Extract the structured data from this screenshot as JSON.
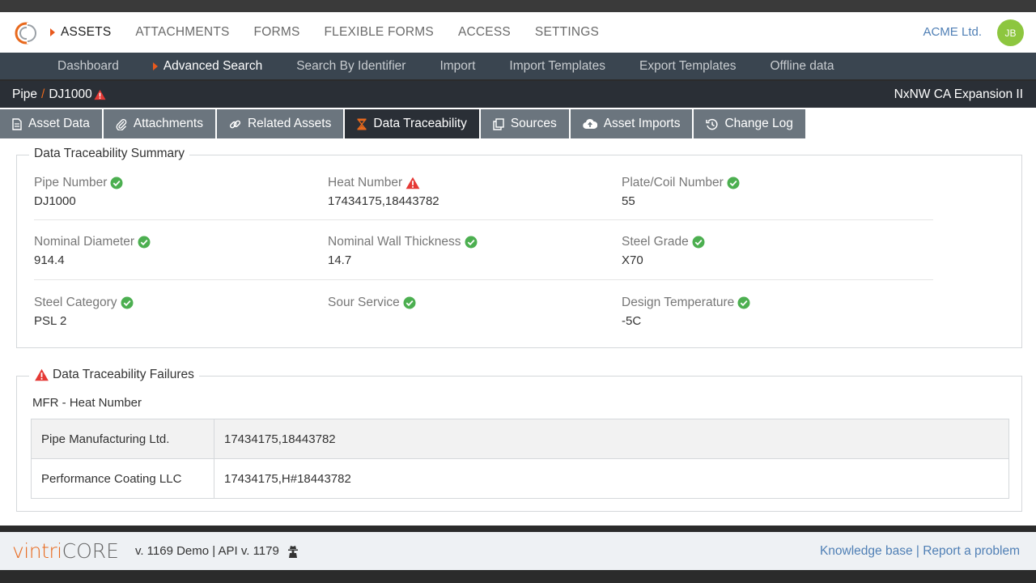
{
  "colors": {
    "accent": "#e8591d",
    "ok": "#4caf50",
    "warn": "#e53935",
    "avatar": "#8dc63f",
    "link": "#4f7fb5"
  },
  "topnav": {
    "items": [
      "ASSETS",
      "ATTACHMENTS",
      "FORMS",
      "FLEXIBLE FORMS",
      "ACCESS",
      "SETTINGS"
    ],
    "company": "ACME Ltd.",
    "avatar_initials": "JB"
  },
  "subnav": {
    "items": [
      "Dashboard",
      "Advanced Search",
      "Search By Identifier",
      "Import",
      "Import Templates",
      "Export Templates",
      "Offline data"
    ]
  },
  "breadcrumb": {
    "parent": "Pipe",
    "sep": "/",
    "current": "DJ1000",
    "project": "NxNW CA Expansion II"
  },
  "tabs": [
    "Asset Data",
    "Attachments",
    "Related Assets",
    "Data Traceability",
    "Sources",
    "Asset Imports",
    "Change Log"
  ],
  "summary": {
    "legend": "Data Traceability Summary",
    "fields": [
      {
        "label": "Pipe Number",
        "value": "DJ1000",
        "status": "ok"
      },
      {
        "label": "Heat Number",
        "value": "17434175,18443782",
        "status": "warning"
      },
      {
        "label": "Plate/Coil Number",
        "value": "55",
        "status": "ok"
      },
      {
        "label": "Nominal Diameter",
        "value": "914.4",
        "status": "ok"
      },
      {
        "label": "Nominal Wall Thickness",
        "value": "14.7",
        "status": "ok"
      },
      {
        "label": "Steel Grade",
        "value": "X70",
        "status": "ok"
      },
      {
        "label": "Steel Category",
        "value": "PSL 2",
        "status": "ok"
      },
      {
        "label": "Sour Service",
        "value": "",
        "status": "ok"
      },
      {
        "label": "Design Temperature",
        "value": "-5C",
        "status": "ok"
      }
    ]
  },
  "failures": {
    "legend": "Data Traceability Failures",
    "subtitle": "MFR - Heat Number",
    "rows": [
      {
        "source": "Pipe Manufacturing Ltd.",
        "value": "17434175,18443782"
      },
      {
        "source": "Performance Coating LLC",
        "value": "17434175,H#18443782"
      }
    ]
  },
  "footer": {
    "brand_a": "vintri",
    "brand_b": "CORE",
    "version": "v. 1169 Demo | API v. 1179",
    "link_kb": "Knowledge base",
    "link_sep": "|",
    "link_report": "Report a problem"
  }
}
